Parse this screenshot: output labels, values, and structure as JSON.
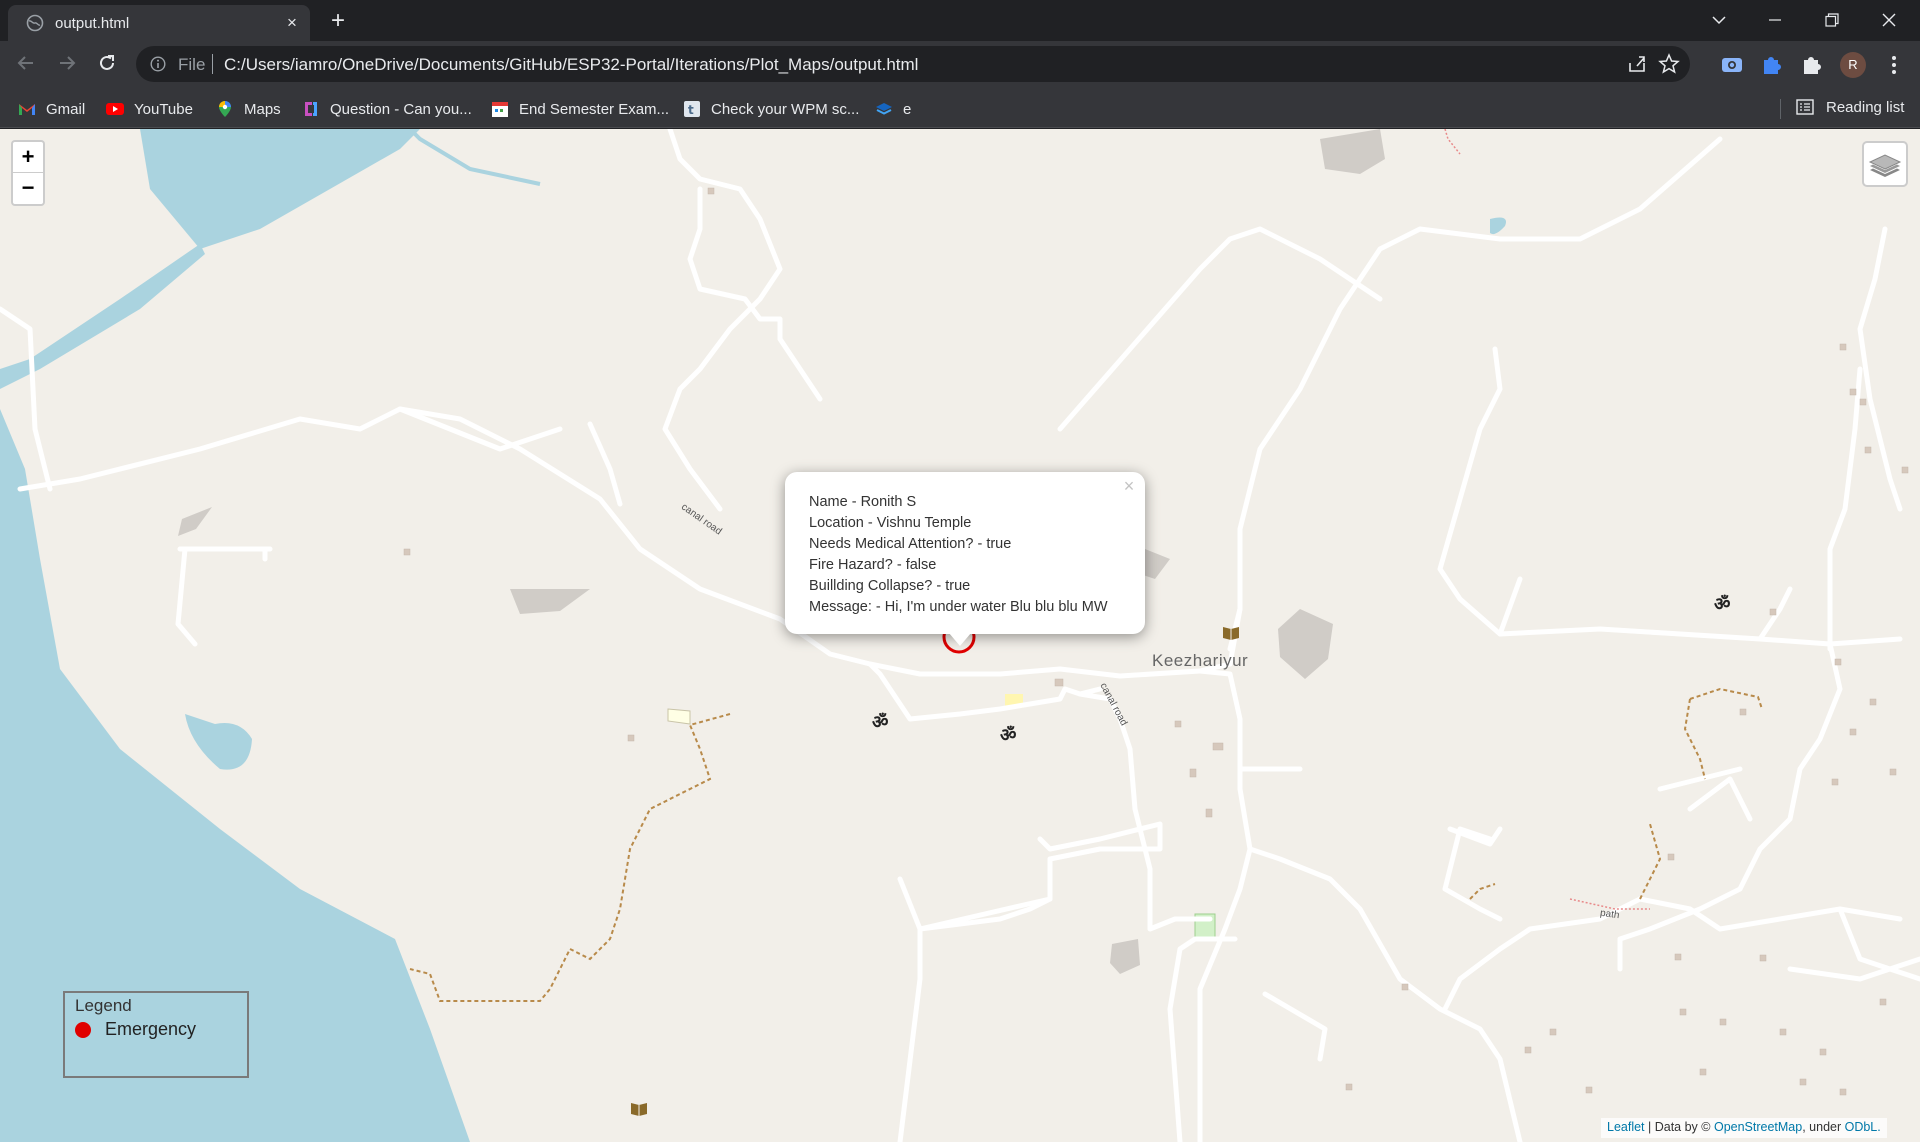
{
  "browser": {
    "tab_title": "output.html",
    "new_tab": "+",
    "tab_close": "×",
    "url_scheme": "File",
    "url": "C:/Users/iamro/OneDrive/Documents/GitHub/ESP32-Portal/Iterations/Plot_Maps/output.html",
    "profile_initial": "R",
    "window_controls": [
      "chevron-down-icon",
      "minimize-icon",
      "restore-icon",
      "close-icon"
    ]
  },
  "bookmarks": [
    {
      "label": "Gmail",
      "icon": "gmail-icon"
    },
    {
      "label": "YouTube",
      "icon": "youtube-icon"
    },
    {
      "label": "Maps",
      "icon": "maps-icon"
    },
    {
      "label": "Question - Can you...",
      "icon": "question-icon"
    },
    {
      "label": "End Semester Exam...",
      "icon": "calendar-icon"
    },
    {
      "label": "Check your WPM sc...",
      "icon": "typing-icon"
    },
    {
      "label": "e",
      "icon": "stack-icon"
    }
  ],
  "reading_list": "Reading list",
  "map": {
    "zoom_in": "+",
    "zoom_out": "−",
    "place": "Keezhariyur",
    "road_labels": [
      "canal road",
      "canal road",
      "path"
    ],
    "om_symbol": "ॐ",
    "colors": {
      "water": "#aad3df",
      "land": "#f2efe9",
      "road": "#ffffff",
      "marker": "#e00000"
    }
  },
  "popup": {
    "close": "×",
    "lines": [
      "Name - Ronith S",
      "Location - Vishnu Temple",
      "Needs Medical Attention? - true",
      "Fire Hazard? - false",
      "Buillding Collapse? - true",
      "Message: - Hi, I'm under water Blu blu blu MW"
    ]
  },
  "legend": {
    "title": "Legend",
    "items": [
      {
        "label": "Emergency",
        "color": "#e00000"
      }
    ]
  },
  "attribution": {
    "leaflet": "Leaflet",
    "sep": " | Data by © ",
    "osm": "OpenStreetMap",
    "under": ", under ",
    "odbl": "ODbL."
  }
}
